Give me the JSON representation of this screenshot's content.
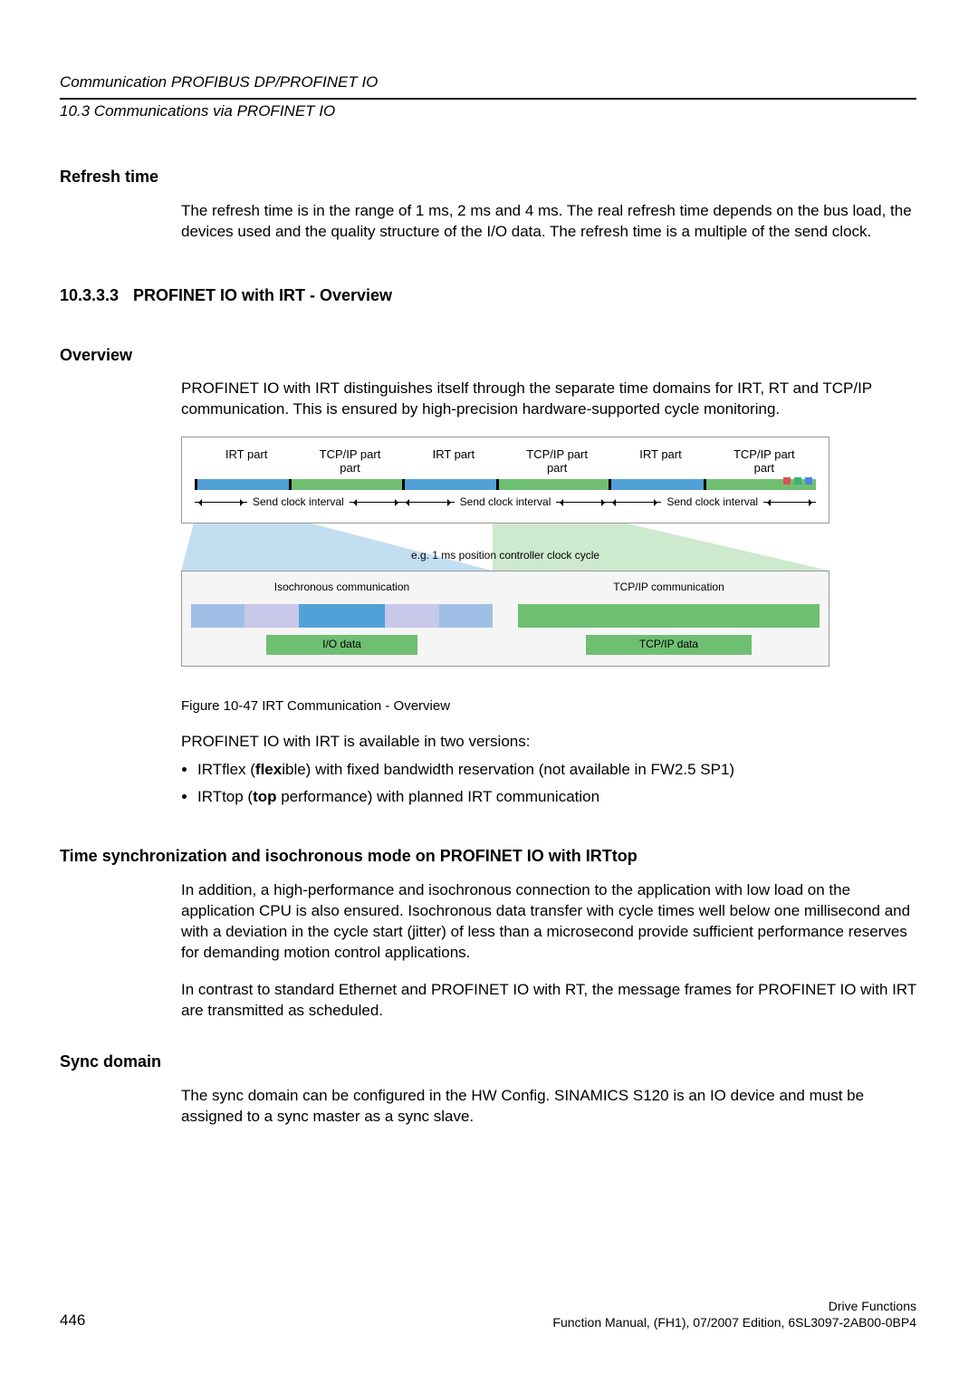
{
  "header": {
    "chapter": "Communication PROFIBUS DP/PROFINET IO",
    "section": "10.3 Communications via PROFINET IO"
  },
  "refresh": {
    "heading": "Refresh time",
    "body": "The refresh time is in the range of 1 ms, 2 ms and 4 ms. The real refresh time depends on the bus load, the devices used and the quality structure of the I/O data. The refresh time is a multiple of the send clock."
  },
  "sec_number": "10.3.3.3",
  "sec_title": "PROFINET IO with IRT - Overview",
  "overview": {
    "heading": "Overview",
    "intro": "PROFINET IO with IRT distinguishes itself through the separate time domains for IRT, RT and TCP/IP communication. This is ensured by high-precision hardware-supported cycle monitoring.",
    "figure_caption": "Figure 10-47  IRT Communication - Overview",
    "available_line": "PROFINET IO with IRT is available in two versions:",
    "bullets": [
      {
        "pre": "IRTflex (",
        "bold": "flex",
        "post": "ible) with fixed bandwidth reservation (not available in FW2.5 SP1)"
      },
      {
        "pre": "IRTtop (",
        "bold": "top",
        "post": " performance) with planned IRT communication"
      }
    ]
  },
  "diagram": {
    "labels": {
      "irt": "IRT part",
      "tcp": "TCP/IP part",
      "sci": "Send clock interval",
      "pos": "e.g. 1 ms position controller clock cycle"
    },
    "detail": {
      "iso": "Isochronous communication",
      "tcpcomm": "TCP/IP communication",
      "iodata": "I/O data",
      "tcpipdata": "TCP/IP data"
    }
  },
  "timesync": {
    "heading": "Time synchronization and isochronous mode on PROFINET IO with IRTtop",
    "p1": "In addition, a high-performance and isochronous connection to the application with low load on the application CPU is also ensured. Isochronous data transfer with cycle times well below one millisecond and with a deviation in the cycle start (jitter) of less than a microsecond provide sufficient performance reserves for demanding motion control applications.",
    "p2": "In contrast to standard Ethernet and PROFINET IO with RT, the message frames for PROFINET IO with IRT are transmitted as scheduled."
  },
  "syncdomain": {
    "heading": "Sync domain",
    "body": "The sync domain can be configured in the HW Config. SINAMICS S120 is an IO device and must be assigned to a sync master as a sync slave."
  },
  "footer": {
    "page": "446",
    "right1": "Drive Functions",
    "right2": "Function Manual, (FH1), 07/2007 Edition, 6SL3097-2AB00-0BP4"
  }
}
